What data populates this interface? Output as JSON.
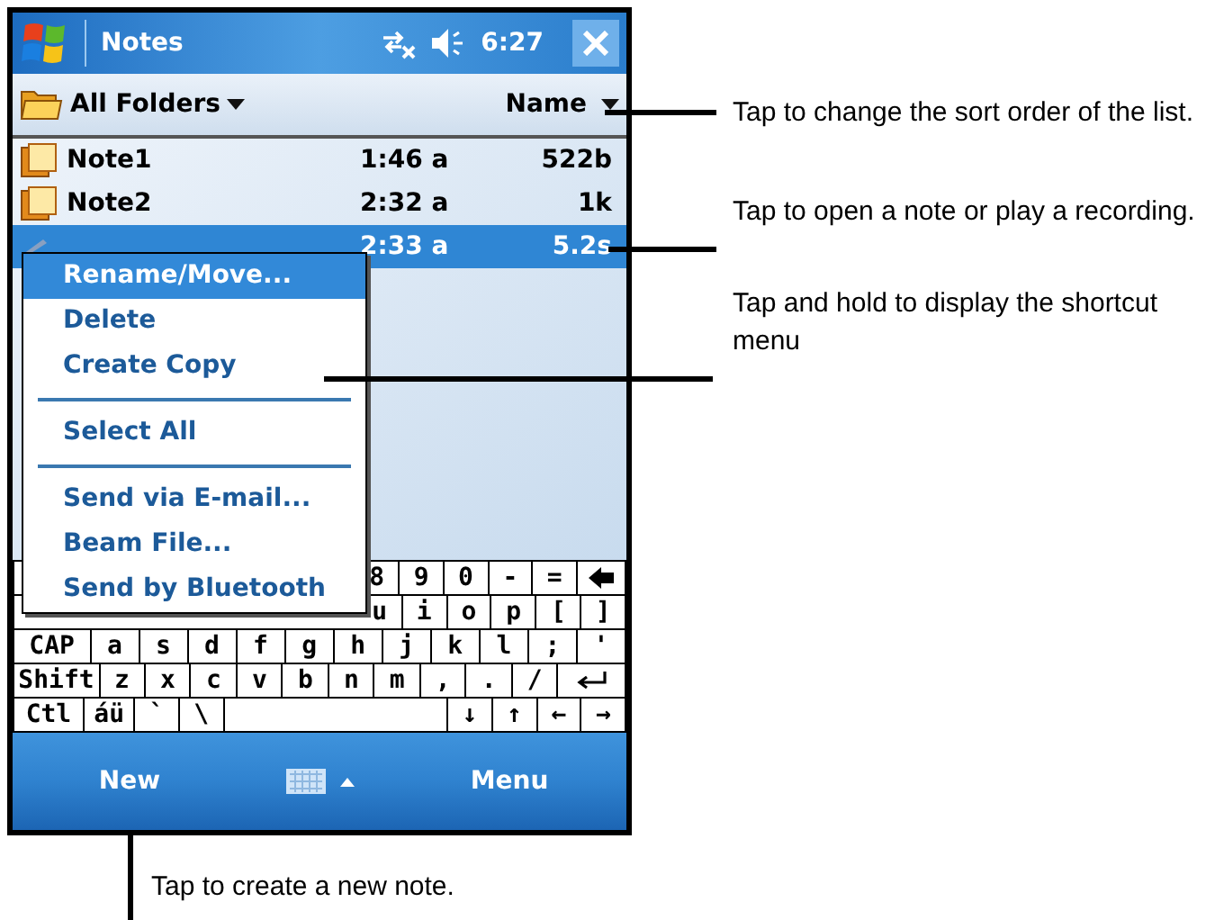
{
  "title_bar": {
    "title": "Notes",
    "time": "6:27"
  },
  "folder_bar": {
    "folder": "All Folders",
    "sort": "Name"
  },
  "notes": [
    {
      "kind": "note",
      "name": "Note1",
      "time": "1:46 a",
      "size": "522b",
      "selected": false
    },
    {
      "kind": "note",
      "name": "Note2",
      "time": "2:32 a",
      "size": "1k",
      "selected": false
    },
    {
      "kind": "recording",
      "time": "2:33 a",
      "size": "5.2s",
      "selected": true
    }
  ],
  "context_menu": [
    {
      "kind": "item",
      "label": "Rename/Move...",
      "selected": true
    },
    {
      "kind": "item",
      "label": "Delete",
      "selected": false
    },
    {
      "kind": "item",
      "label": "Create Copy",
      "selected": false
    },
    {
      "kind": "separator"
    },
    {
      "kind": "item",
      "label": "Select All",
      "selected": false
    },
    {
      "kind": "separator"
    },
    {
      "kind": "item",
      "label": "Send via E-mail...",
      "selected": false
    },
    {
      "kind": "item",
      "label": "Beam File...",
      "selected": false
    },
    {
      "kind": "item",
      "label": "Send by Bluetooth",
      "selected": false
    }
  ],
  "keyboard": [
    [
      {
        "label": "8"
      },
      {
        "label": "9"
      },
      {
        "label": "0"
      },
      {
        "label": "-"
      },
      {
        "label": "="
      },
      {
        "kind": "backspace"
      }
    ],
    [
      {
        "label": "u"
      },
      {
        "label": "i"
      },
      {
        "label": "o"
      },
      {
        "label": "p"
      },
      {
        "label": "["
      },
      {
        "label": "]"
      }
    ],
    [
      {
        "label": "CAP"
      },
      {
        "label": "a"
      },
      {
        "label": "s"
      },
      {
        "label": "d"
      },
      {
        "label": "f"
      },
      {
        "label": "g"
      },
      {
        "label": "h"
      },
      {
        "label": "j"
      },
      {
        "label": "k"
      },
      {
        "label": "l"
      },
      {
        "label": ";"
      },
      {
        "label": "'"
      }
    ],
    [
      {
        "label": "Shift"
      },
      {
        "label": "z"
      },
      {
        "label": "x"
      },
      {
        "label": "c"
      },
      {
        "label": "v"
      },
      {
        "label": "b"
      },
      {
        "label": "n"
      },
      {
        "label": "m"
      },
      {
        "label": ","
      },
      {
        "label": "."
      },
      {
        "label": "/"
      },
      {
        "kind": "enter"
      }
    ],
    [
      {
        "label": "Ctl"
      },
      {
        "label": "áü"
      },
      {
        "label": "`"
      },
      {
        "label": "\\"
      },
      {
        "kind": "space"
      },
      {
        "label": "↓"
      },
      {
        "label": "↑"
      },
      {
        "label": "←"
      },
      {
        "label": "→"
      }
    ]
  ],
  "bottom_bar": {
    "left": "New",
    "right": "Menu"
  },
  "callouts": [
    "Tap to change the sort order of the list.",
    "Tap to open a note or play a recording.",
    "Tap and hold to display the shortcut menu"
  ],
  "bottom_callout": "Tap to create a new note."
}
